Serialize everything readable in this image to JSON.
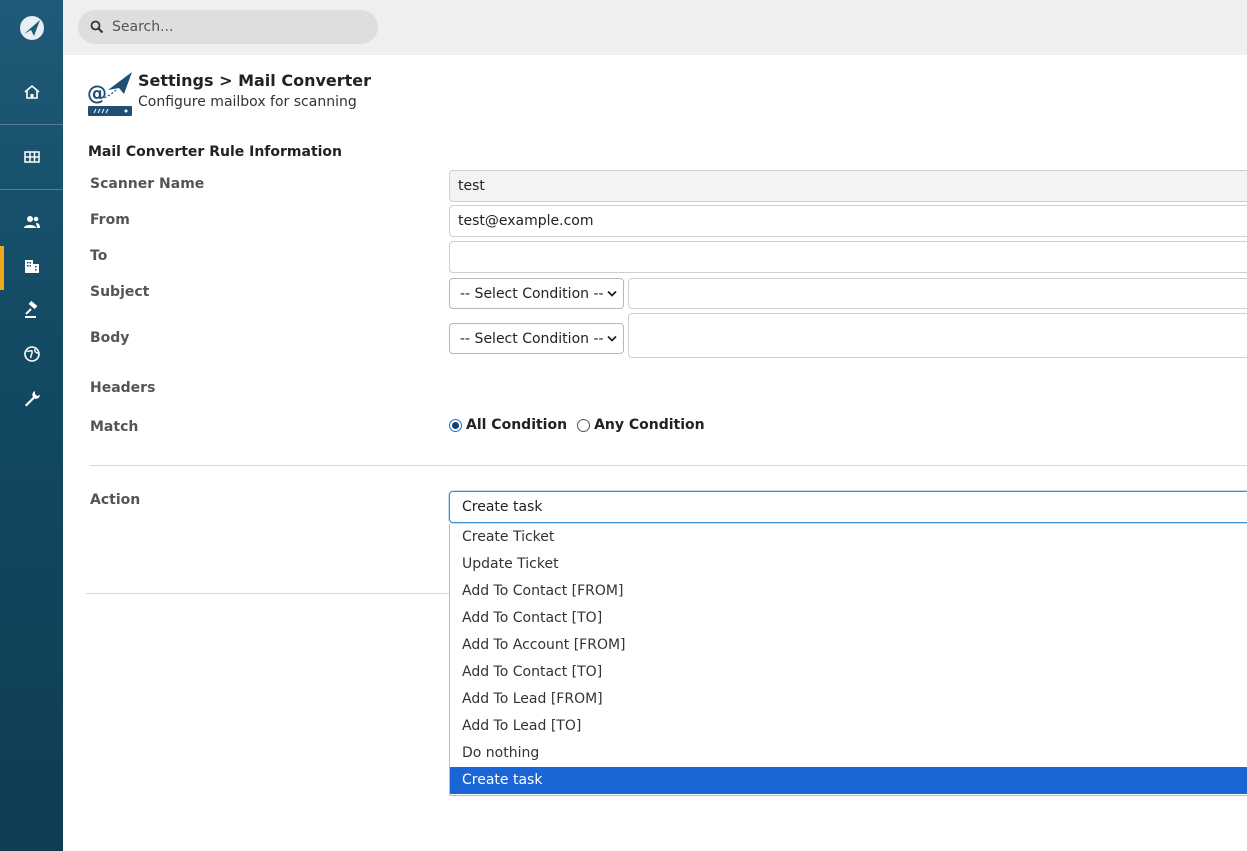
{
  "search": {
    "placeholder": "Search..."
  },
  "header": {
    "title": "Settings > Mail Converter",
    "subtitle": "Configure mailbox for scanning"
  },
  "section": {
    "title": "Mail Converter Rule Information"
  },
  "form": {
    "scanner_name": {
      "label": "Scanner Name",
      "value": "test"
    },
    "from": {
      "label": "From",
      "value": "test@example.com"
    },
    "to": {
      "label": "To",
      "value": ""
    },
    "subject": {
      "label": "Subject",
      "condition": "-- Select Condition --",
      "value": ""
    },
    "body": {
      "label": "Body",
      "condition": "-- Select Condition --",
      "value": ""
    },
    "headers": {
      "label": "Headers"
    },
    "match": {
      "label": "Match",
      "options": [
        "All Condition",
        "Any Condition"
      ],
      "selected": "All Condition"
    },
    "action": {
      "label": "Action",
      "value": "Create task",
      "options": [
        "Create Ticket",
        "Update Ticket",
        "Add To Contact [FROM]",
        "Add To Contact [TO]",
        "Add To Account [FROM]",
        "Add To Contact [TO]",
        "Add To Lead [FROM]",
        "Add To Lead [TO]",
        "Do nothing",
        "Create task"
      ],
      "selected_index": 9
    }
  },
  "colors": {
    "sidebar": "#134a63",
    "accent": "#f0a821",
    "selection": "#1a66d6"
  },
  "sidebar": {
    "icons": [
      "app-logo-icon",
      "home-icon",
      "grid-icon",
      "contacts-icon",
      "building-icon",
      "gavel-icon",
      "globe-icon",
      "wrench-icon"
    ]
  }
}
